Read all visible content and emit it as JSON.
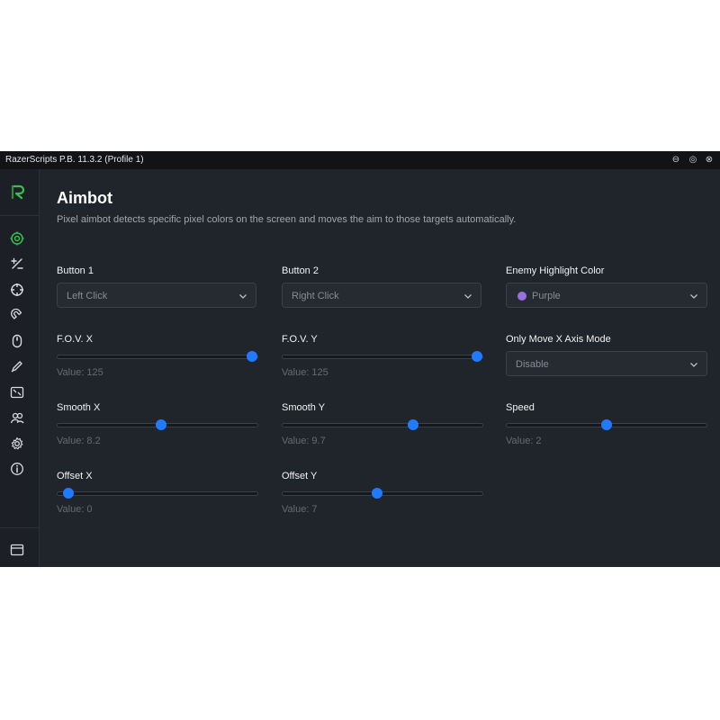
{
  "window": {
    "title": "RazerScripts P.B. 11.3.2 (Profile 1)",
    "controls": [
      "minimize-icon",
      "maximize-icon",
      "close-icon"
    ]
  },
  "colors": {
    "accent": "#1f7aff",
    "active_nav": "#36c24a",
    "background": "#20242b",
    "purple": "#9b6fe0"
  },
  "sidebar": {
    "items": [
      {
        "icon": "crosshair-target-icon",
        "active": true
      },
      {
        "icon": "plus-minus-icon",
        "active": false
      },
      {
        "icon": "scope-icon",
        "active": false
      },
      {
        "icon": "magnet-icon",
        "active": false
      },
      {
        "icon": "mouse-icon",
        "active": false
      },
      {
        "icon": "pen-icon",
        "active": false
      },
      {
        "icon": "screen-capture-icon",
        "active": false
      },
      {
        "icon": "users-icon",
        "active": false
      },
      {
        "icon": "gear-icon",
        "active": false
      },
      {
        "icon": "info-icon",
        "active": false
      }
    ],
    "bottom_icon": "window-icon"
  },
  "page": {
    "title": "Aimbot",
    "description": "Pixel aimbot detects specific pixel colors on the screen and moves the aim to those targets automatically."
  },
  "fields": {
    "button1": {
      "label": "Button 1",
      "value": "Left Click"
    },
    "button2": {
      "label": "Button 2",
      "value": "Right Click"
    },
    "enemy_color": {
      "label": "Enemy Highlight Color",
      "value": "Purple"
    },
    "only_move_x": {
      "label": "Only Move X Axis Mode",
      "value": "Disable"
    },
    "fov_x": {
      "label": "F.O.V. X",
      "value_text": "Value: 125",
      "level": 1.0
    },
    "fov_y": {
      "label": "F.O.V. Y",
      "value_text": "Value: 125",
      "level": 1.0
    },
    "smooth_x": {
      "label": "Smooth X",
      "value_text": "Value: 8.2",
      "level": 0.52
    },
    "smooth_y": {
      "label": "Smooth Y",
      "value_text": "Value: 9.7",
      "level": 0.66
    },
    "speed": {
      "label": "Speed",
      "value_text": "Value: 2",
      "level": 0.5
    },
    "offset_x": {
      "label": "Offset X",
      "value_text": "Value: 0",
      "level": 0.03
    },
    "offset_y": {
      "label": "Offset Y",
      "value_text": "Value: 7",
      "level": 0.47
    }
  }
}
